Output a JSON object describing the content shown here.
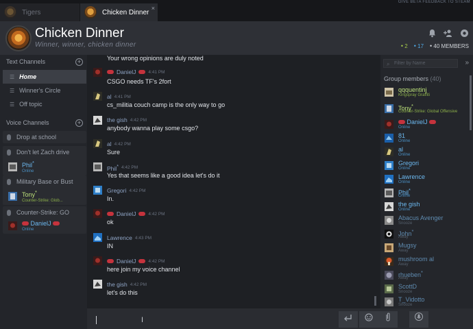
{
  "tabs": [
    {
      "label": "Tigers"
    },
    {
      "label": "Chicken Dinner",
      "close": "×"
    }
  ],
  "steam_hint": "GIVE BETA FEEDBACK TO STEAM",
  "header": {
    "title": "Chicken Dinner",
    "tagline": "Winner, winner, chicken dinner",
    "stats": {
      "in_game": "2",
      "online": "17",
      "members": "40 MEMBERS"
    }
  },
  "text_channels": {
    "heading": "Text Channels",
    "add": "+",
    "items": [
      {
        "label": "Home",
        "selected": true
      },
      {
        "label": "Winner's Circle"
      },
      {
        "label": "Off topic"
      }
    ]
  },
  "voice_channels": {
    "heading": "Voice Channels",
    "add": "+",
    "items": [
      {
        "label": "Drop at school",
        "members": []
      },
      {
        "label": "Don't let Zach drive",
        "members": [
          {
            "name": "Phil",
            "sup": "*",
            "status": "Online"
          }
        ]
      },
      {
        "label": "Military Base or Bust",
        "members": [
          {
            "name": "Tony",
            "sup": "*",
            "status": "Counter-Strike: Glob..."
          }
        ]
      },
      {
        "label": "Counter-Strike: GO",
        "members": [
          {
            "name": "DanielJ",
            "status": "Online"
          }
        ]
      }
    ]
  },
  "messages": [
    {
      "text": "Your wrong opinions are duly noted"
    },
    {
      "name": "DanielJ",
      "time": "4:41 PM",
      "text": "CSGO needs TF's 2fort"
    },
    {
      "name": "al",
      "time": "4:41 PM",
      "text": "cs_militia couch camp is the only way to go"
    },
    {
      "name": "the gish",
      "time": "4:42 PM",
      "text": "anybody wanna play some csgo?"
    },
    {
      "name": "al",
      "time": "4:42 PM",
      "text": "Sure"
    },
    {
      "name": "Phil",
      "sup": "*",
      "time": "4:42 PM",
      "text": "Yes that seems like a good idea let's do it"
    },
    {
      "name": "Gregori",
      "time": "4:42 PM",
      "text": "In."
    },
    {
      "name": "DanielJ",
      "time": "4:42 PM",
      "text": "ok"
    },
    {
      "name": "Lawrence",
      "time": "4:43 PM",
      "text": "IN"
    },
    {
      "name": "DanielJ",
      "time": "4:42 PM",
      "text": "here join my voice channel"
    },
    {
      "name": "the gish",
      "time": "4:42 PM",
      "text": "let's do this"
    }
  ],
  "member_panel": {
    "filter_placeholder": "Filter by Name",
    "heading": "Group members",
    "count": "(40)",
    "members": [
      {
        "name": "qqquentinj",
        "status": "Kingspray Graffiti",
        "state": "ingame"
      },
      {
        "name": "Tony",
        "sup": "*",
        "status": "Counter-Strike: Global Offensive",
        "state": "ingame"
      },
      {
        "name": "DanielJ",
        "status": "Online",
        "state": "online"
      },
      {
        "name": "81",
        "status": "Online",
        "state": "online"
      },
      {
        "name": "al",
        "status": "Online",
        "state": "online"
      },
      {
        "name": "Gregori",
        "status": "Online",
        "state": "online"
      },
      {
        "name": "Lawrence",
        "status": "Online",
        "state": "online"
      },
      {
        "name": "Phil",
        "sup": "*",
        "status": "Online",
        "state": "online"
      },
      {
        "name": "the gish",
        "status": "Online",
        "state": "online"
      },
      {
        "name": "Abacus Avenger",
        "status": "Snooze",
        "state": "snooze"
      },
      {
        "name": "John",
        "sup": "*",
        "status": "Away",
        "state": "away"
      },
      {
        "name": "Mugsy",
        "status": "Away",
        "state": "away"
      },
      {
        "name": "mushroom al",
        "status": "Away",
        "state": "away"
      },
      {
        "name": "rhueben",
        "sup": "*",
        "status": "Away",
        "state": "away"
      },
      {
        "name": "ScottD",
        "status": "Snooze",
        "state": "snooze"
      },
      {
        "name": "T_Vidotto",
        "status": "Snooze",
        "state": "snooze"
      }
    ]
  },
  "colors": {
    "accent_online": "#6cb8ef",
    "accent_ingame": "#bde17a",
    "role_tag": "#c5333d"
  }
}
